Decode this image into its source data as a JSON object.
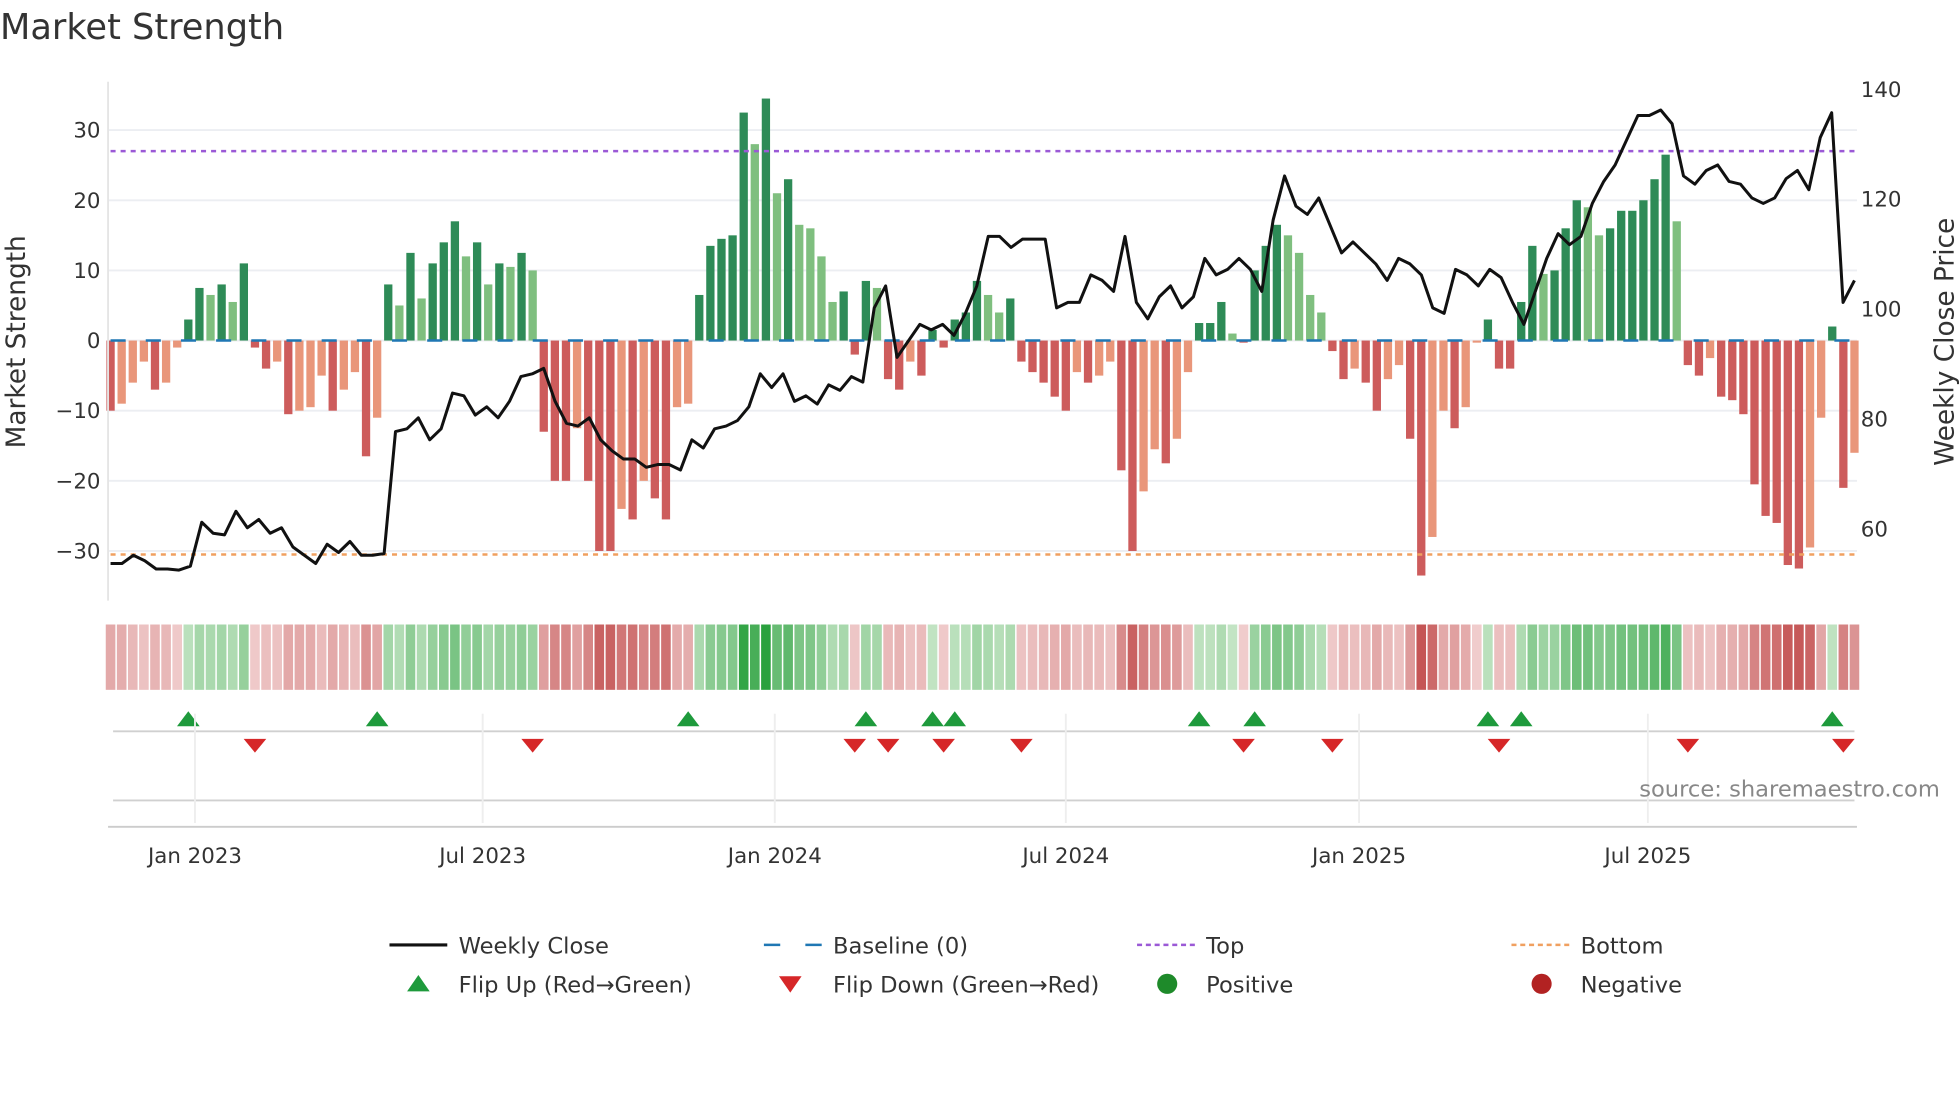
{
  "chart_data": {
    "type": "bar",
    "title": "Market Strength",
    "ylabel": "Market Strength",
    "y2label": "Weekly Close Price",
    "ylim": [
      -37,
      37
    ],
    "y2lim": [
      48,
      141
    ],
    "yticks": [
      30,
      20,
      10,
      0,
      -10,
      -20,
      -30
    ],
    "ytick_labels": [
      "30",
      "20",
      "10",
      "0",
      "−10",
      "−20",
      "−30"
    ],
    "y2ticks": [
      140,
      120,
      100,
      80,
      60
    ],
    "y2tick_labels": [
      "140",
      "120",
      "100",
      "80",
      "60"
    ],
    "xticks": [
      {
        "label": "Jan 2023",
        "week": 7.6
      },
      {
        "label": "Jul 2023",
        "week": 33.5
      },
      {
        "label": "Jan 2024",
        "week": 59.8
      },
      {
        "label": "Jul 2024",
        "week": 86
      },
      {
        "label": "Jan 2025",
        "week": 112.4
      },
      {
        "label": "Jul 2025",
        "week": 138.4
      }
    ],
    "top_level": 27,
    "bottom_level": -30.5,
    "baseline": 0,
    "strength": [
      -10,
      -9,
      -6,
      -3,
      -7,
      -6,
      -1,
      3,
      7.5,
      6.5,
      8,
      5.5,
      11,
      -1,
      -4,
      -3,
      -10.5,
      -10,
      -9.5,
      -5,
      -10,
      -7,
      -4.5,
      -16.5,
      -11,
      8,
      5,
      12.5,
      6,
      11,
      14,
      17,
      12,
      14,
      8,
      11,
      10.5,
      12.5,
      10,
      -13,
      -20,
      -20,
      -12.5,
      -20,
      -30,
      -30,
      -24,
      -25.5,
      -20,
      -22.5,
      -25.5,
      -9.5,
      -9,
      6.5,
      13.5,
      14.5,
      15,
      32.5,
      28,
      34.5,
      21,
      23,
      16.5,
      16,
      12,
      5.5,
      7,
      -2,
      8.5,
      7.5,
      -5.5,
      -7,
      -3,
      -5,
      1.5,
      -1,
      3,
      4,
      8.5,
      6.5,
      4,
      6,
      -3,
      -4.5,
      -6,
      -8,
      -10,
      -4.5,
      -6,
      -5,
      -3,
      -18.5,
      -30,
      -21.5,
      -15.5,
      -17.5,
      -14,
      -4.5,
      2.5,
      2.5,
      5.5,
      1,
      -0.3,
      10,
      13.5,
      16.5,
      15,
      12.5,
      6.5,
      4,
      -1.5,
      -5.5,
      -4,
      -6,
      -10,
      -5.5,
      -3.5,
      -14,
      -33.5,
      -28,
      -10,
      -12.5,
      -9.5,
      -0.3,
      3,
      -4,
      -4,
      5.5,
      13.5,
      9.5,
      10,
      16,
      20,
      19,
      15,
      16,
      18.5,
      18.5,
      20,
      23,
      26.5,
      17,
      -3.5,
      -5,
      -2.5,
      -8,
      -8.5,
      -10.5,
      -20.5,
      -25,
      -26,
      -32,
      -32.5,
      -29.5,
      -11,
      2,
      -21,
      -16
    ],
    "close": [
      53.5,
      53.5,
      55,
      54,
      52.5,
      52.5,
      52.3,
      53,
      61,
      59,
      58.7,
      63,
      60,
      61.5,
      59,
      60,
      56.5,
      55,
      53.5,
      57,
      55.5,
      57.5,
      55,
      55,
      55.3,
      77.5,
      78,
      80,
      76,
      78,
      84.5,
      84,
      80.5,
      82,
      80,
      83,
      87.5,
      88,
      89,
      83,
      79,
      78.5,
      80,
      76,
      74,
      72.5,
      72.5,
      71,
      71.5,
      71.5,
      70.5,
      76,
      74.5,
      78,
      78.5,
      79.5,
      82,
      88,
      85.5,
      88,
      83,
      84,
      82.5,
      86,
      85,
      87.5,
      86.5,
      100,
      104,
      91,
      94,
      97,
      96,
      97,
      95,
      99,
      104,
      113,
      113,
      111,
      112.5,
      112.5,
      112.5,
      100,
      101,
      101,
      106,
      105,
      103,
      113,
      101,
      98,
      102,
      104,
      100,
      102,
      109,
      106,
      107,
      109,
      107,
      103,
      116,
      124,
      118.5,
      117,
      120,
      115,
      110,
      112,
      110,
      108,
      105,
      109,
      108,
      106,
      100,
      99,
      107,
      106,
      104,
      107,
      105.5,
      101,
      97,
      103,
      109,
      113.5,
      111.5,
      113,
      119,
      123,
      126,
      130.5,
      135,
      135,
      136,
      133.5,
      124,
      122.5,
      125,
      126,
      123,
      122.5,
      120,
      119,
      120,
      123.5,
      125,
      121.5,
      131,
      135.5,
      101,
      105
    ],
    "flip_up_weeks": [
      7,
      24,
      52,
      68,
      74,
      76,
      98,
      103,
      124,
      127,
      155
    ],
    "flip_down_weeks": [
      13,
      38,
      67,
      70,
      75,
      82,
      102,
      110,
      125,
      142,
      156
    ],
    "legend": [
      {
        "label": "Weekly Close",
        "icon": "solid-line",
        "color": "#111111"
      },
      {
        "label": "Baseline (0)",
        "icon": "dashed-line",
        "color": "#1f77b4"
      },
      {
        "label": "Top",
        "icon": "dotted-line",
        "color": "#9b59d6"
      },
      {
        "label": "Bottom",
        "icon": "dotted-line",
        "color": "#f0a060"
      },
      {
        "label": "Flip Up (Red→Green)",
        "icon": "triangle-up",
        "color": "#1e9a3c"
      },
      {
        "label": "Flip Down (Green→Red)",
        "icon": "triangle-down",
        "color": "#d62728"
      },
      {
        "label": "Positive",
        "icon": "circle",
        "color": "#1e8a2a"
      },
      {
        "label": "Negative",
        "icon": "circle",
        "color": "#b22222"
      }
    ],
    "colors": {
      "pos_dark": "#2e8b57",
      "pos_light": "#7fbf7f",
      "neg_dark": "#cd5c5c",
      "neg_light": "#e9967a",
      "close": "#111111",
      "top": "#9b59d6",
      "bottom": "#f0a060",
      "baseline": "#1f77b4"
    },
    "source": "source: sharemaestro.com"
  }
}
